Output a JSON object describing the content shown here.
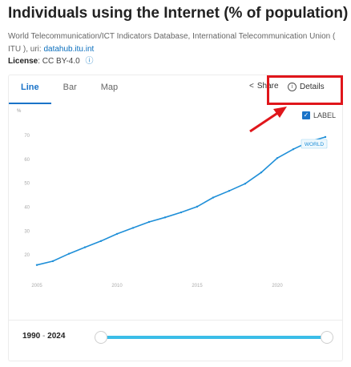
{
  "header": {
    "title": "Individuals using the Internet (% of population)",
    "source_prefix": "World Telecommunication/ICT Indicators Database, International Telecommunication Union ( ITU ), uri:",
    "source_link": "datahub.itu.int",
    "license_label": "License",
    "license_value": ": CC BY-4.0"
  },
  "tabs": [
    {
      "label": "Line",
      "active": true
    },
    {
      "label": "Bar",
      "active": false
    },
    {
      "label": "Map",
      "active": false
    }
  ],
  "toolbar": {
    "share_label": "Share",
    "details_label": "Details",
    "highlight_color": "#e0161b"
  },
  "legend": {
    "label": "LABEL",
    "checked": true
  },
  "range": {
    "start": "1990",
    "separator": " - ",
    "end": "2024"
  },
  "chart_data": {
    "type": "line",
    "title": "",
    "xlabel": "",
    "ylabel": "%",
    "xlim": [
      2005,
      2023
    ],
    "ylim": [
      10,
      75
    ],
    "x_ticks": [
      2005,
      2010,
      2015,
      2020
    ],
    "y_ticks": [
      20,
      30,
      40,
      50,
      60,
      70
    ],
    "grid": false,
    "series": [
      {
        "name": "WORLD",
        "color": "#1f8fd8",
        "x": [
          2005,
          2006,
          2007,
          2008,
          2009,
          2010,
          2011,
          2012,
          2013,
          2014,
          2015,
          2016,
          2017,
          2018,
          2019,
          2020,
          2021,
          2022,
          2023
        ],
        "values": [
          15.8,
          17.4,
          20.5,
          23.2,
          25.8,
          28.8,
          31.3,
          33.8,
          35.7,
          37.8,
          40.2,
          44.0,
          46.8,
          49.8,
          54.5,
          60.5,
          64.2,
          67.4,
          69.3
        ]
      }
    ],
    "end_label": "WORLD"
  }
}
